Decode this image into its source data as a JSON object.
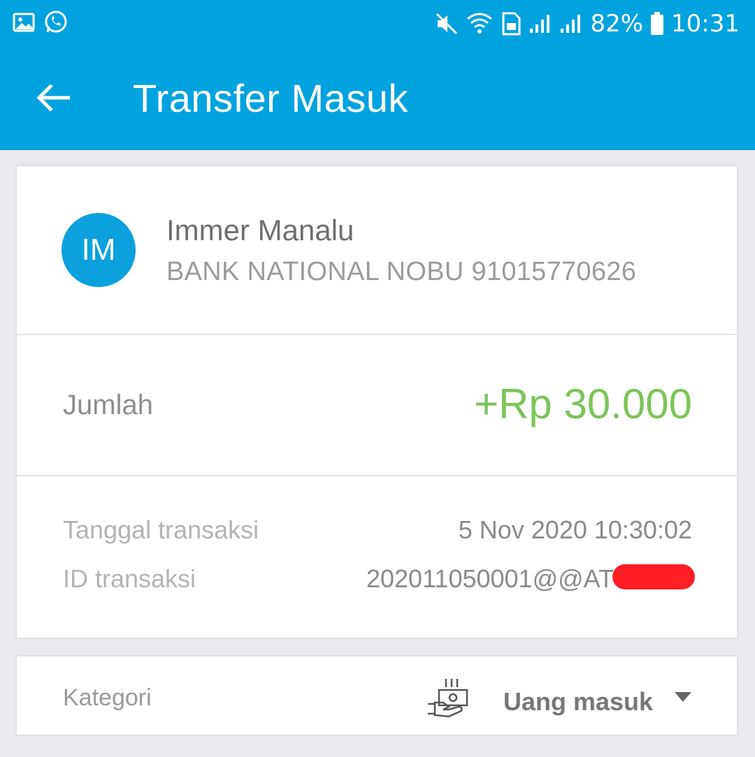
{
  "status_bar": {
    "battery_percent": "82%",
    "time": "10:31",
    "icons": [
      "gallery-icon",
      "whatsapp-icon",
      "mute-icon",
      "wifi-icon",
      "sim-icon",
      "signal-icon",
      "signal-icon",
      "battery-icon"
    ]
  },
  "appbar": {
    "title": "Transfer Masuk",
    "back_icon": "arrow-back-icon",
    "background": "#00a3de"
  },
  "sender": {
    "initials": "IM",
    "name": "Immer Manalu",
    "bank_account": "BANK NATIONAL NOBU 91015770626",
    "avatar_color": "#0aa1dd"
  },
  "amount": {
    "label": "Jumlah",
    "value": "+Rp 30.000",
    "color": "#7dc35b"
  },
  "details": {
    "date_label": "Tanggal transaksi",
    "date_value": "5 Nov 2020 10:30:02",
    "id_label": "ID transaksi",
    "id_value": "202011050001@@AT"
  },
  "category": {
    "label": "Kategori",
    "icon": "money-in-icon",
    "value": "Uang masuk",
    "dropdown_icon": "caret-down-icon"
  }
}
